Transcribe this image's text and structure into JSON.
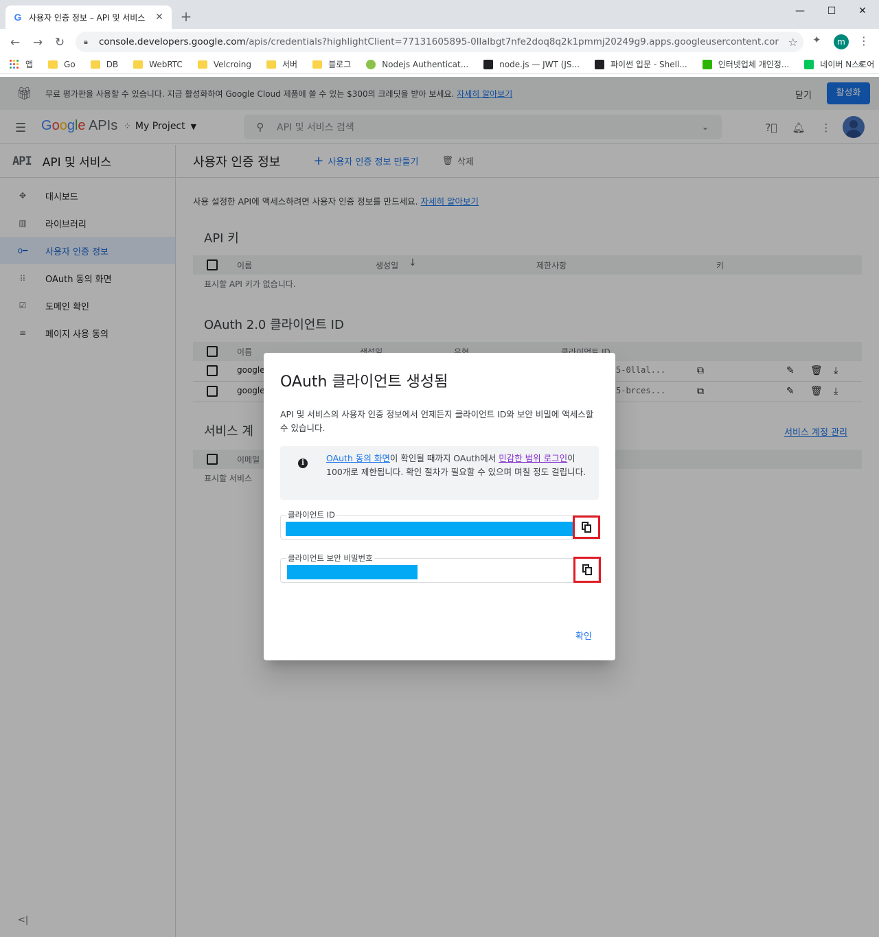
{
  "browser": {
    "tab_title": "사용자 인증 정보 – API 및 서비스",
    "favicon": "G",
    "url_host": "console.developers.google.com",
    "url_rest": "/apis/credentials?highlightClient=77131605895-0llalbgt7nfe2doq8q2k1pmmj20249g9.apps.googleusercontent.com&projec...",
    "profile_initial": "m",
    "bookmarks": [
      "앱",
      "Go",
      "DB",
      "WebRTC",
      "Velcroing",
      "서버",
      "블로그",
      "Nodejs Authenticat...",
      "node.js — JWT (JS...",
      "파이썬 입문 - Shell...",
      "인터넷업체 개인정...",
      "네이버 N스토어"
    ]
  },
  "promo": {
    "text": "무료 평가판을 사용할 수 있습니다. 지금 활성화하여 Google Cloud 제품에 쓸 수 있는 $300의 크레딧을 받아 보세요.",
    "link": "자세히 알아보기",
    "dismiss": "닫기",
    "activate": "활성화"
  },
  "header": {
    "logo_google": [
      "G",
      "o",
      "o",
      "g",
      "l",
      "e"
    ],
    "logo_apis": "APIs",
    "project": "My Project",
    "search_placeholder": "API 및 서비스 검색"
  },
  "sidebar": {
    "api_badge": "API",
    "title": "API 및 서비스",
    "items": [
      {
        "label": "대시보드",
        "icon": "dashboard-icon"
      },
      {
        "label": "라이브러리",
        "icon": "library-icon"
      },
      {
        "label": "사용자 인증 정보",
        "icon": "key-icon"
      },
      {
        "label": "OAuth 동의 화면",
        "icon": "consent-icon"
      },
      {
        "label": "도메인 확인",
        "icon": "domain-check-icon"
      },
      {
        "label": "페이지 사용 동의",
        "icon": "page-settings-icon"
      }
    ]
  },
  "main": {
    "title": "사용자 인증 정보",
    "create": "사용자 인증 정보 만들기",
    "delete": "삭제",
    "intro": "사용 설정한 API에 액세스하려면 사용자 인증 정보를 만드세요.",
    "intro_link": "자세히 알아보기",
    "api_keys": {
      "title": "API 키",
      "columns": [
        "이름",
        "생성일",
        "제한사항",
        "키"
      ],
      "empty": "표시할 API 키가 없습니다."
    },
    "oauth": {
      "title": "OAuth 2.0 클라이언트 ID",
      "columns": [
        "이름",
        "생성일",
        "유형",
        "클라이언트 ID"
      ],
      "rows": [
        {
          "name": "google",
          "client_id": "5-0llal..."
        },
        {
          "name": "google",
          "client_id": "5-brces..."
        }
      ]
    },
    "service": {
      "title": "서비스 계",
      "manage_link": "서비스 계정 관리",
      "columns": [
        "이메일"
      ],
      "empty": "표시할 서비스"
    }
  },
  "dialog": {
    "title": "OAuth 클라이언트 생성됨",
    "description": "API 및 서비스의 사용자 인증 정보에서 언제든지 클라이언트 ID와 보안 비밀에 액세스할 수 있습니다.",
    "info_link1": "OAuth 동의 화면",
    "info_text1": "이 확인될 때까지 OAuth에서 ",
    "info_link2": "민감한 범위 로그인",
    "info_text2": "이 100개로 제한됩니다. 확인 절차가 필요할 수 있으며 며칠 정도 걸립니다.",
    "client_id_label": "클라이언트 ID",
    "client_secret_label": "클라이언트 보안 비밀번호",
    "ok": "확인",
    "redaction_color": "#03a9f4",
    "highlight_color": "#e01b24"
  }
}
